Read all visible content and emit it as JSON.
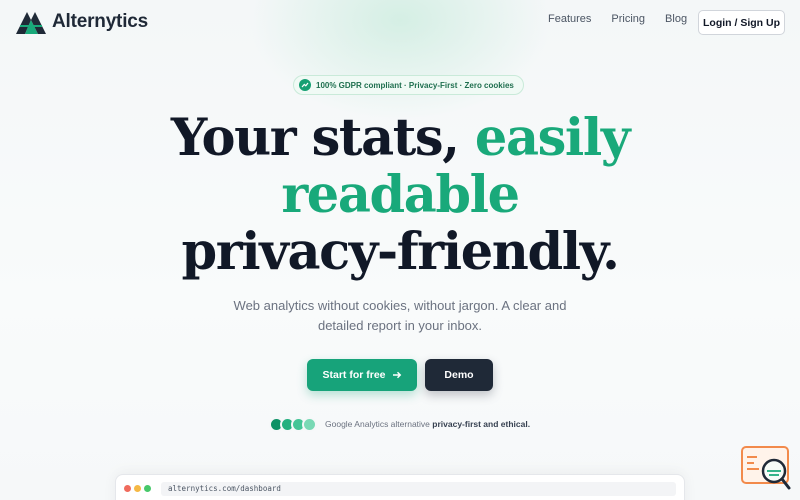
{
  "brand": {
    "name": "Alternytics"
  },
  "nav": {
    "links": [
      "Features",
      "Pricing",
      "Blog"
    ],
    "login_label": "Login / Sign Up"
  },
  "badge": {
    "text": "100% GDPR compliant · Privacy-First · Zero cookies"
  },
  "hero": {
    "line1_part1": "Your stats,",
    "line1_part2": "easily",
    "line2": "readable",
    "line3": "privacy-friendly."
  },
  "subtitle": "Web analytics without cookies, without jargon. A clear and detailed report in your inbox.",
  "cta": {
    "start_label": "Start for free",
    "demo_label": "Demo"
  },
  "proof": {
    "text_plain": "Google Analytics alternative",
    "text_bold": "privacy-first and ethical."
  },
  "browser": {
    "url": "alternytics.com/dashboard"
  },
  "colors": {
    "accent": "#19a97a",
    "dark": "#111827",
    "dots": [
      "#0e9266",
      "#24b07f",
      "#43c596",
      "#79d9b5"
    ],
    "traffic_lights": [
      "#f06b5d",
      "#f5b845",
      "#47c86a"
    ],
    "widget": "#f28a4b"
  },
  "icons": {
    "logo": "logo-icon",
    "badge": "trend-up-icon",
    "cta": "arrow-right-icon",
    "widget": "chat-search-icon"
  }
}
